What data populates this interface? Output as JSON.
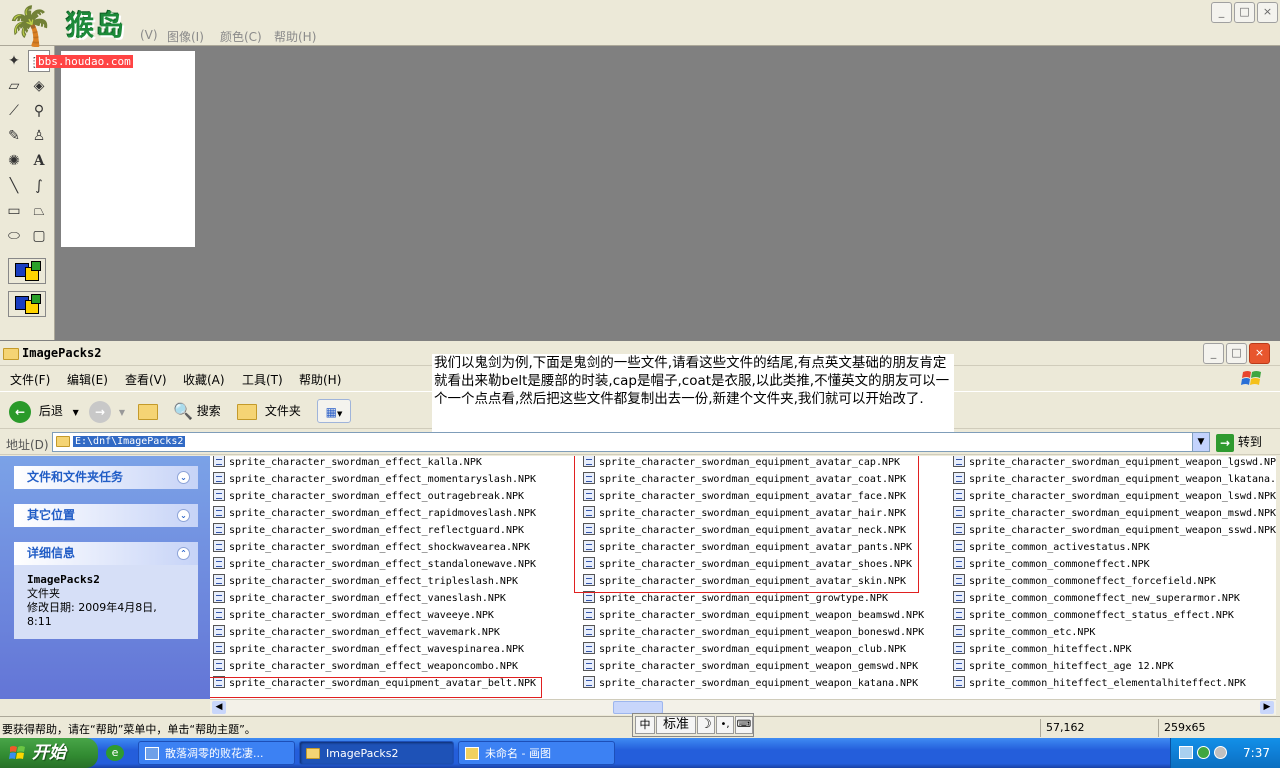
{
  "paint": {
    "menu": [
      "图像(I)",
      "颜色(C)",
      "帮助(H)"
    ],
    "menu_partial": "(V)",
    "logo_brand": "猴岛",
    "logo_site": "bbs.houdao.com"
  },
  "explorer": {
    "title": "ImagePacks2",
    "menu": [
      "文件(F)",
      "编辑(E)",
      "查看(V)",
      "收藏(A)",
      "工具(T)",
      "帮助(H)"
    ],
    "toolbar": {
      "back": "后退",
      "search": "搜索",
      "folders": "文件夹"
    },
    "address": {
      "label": "地址(D)",
      "path": "E:\\dnf\\ImagePacks2",
      "go": "转到"
    },
    "tasks": {
      "file_tasks": "文件和文件夹任务",
      "other_places": "其它位置",
      "details": "详细信息",
      "details_name": "ImagePacks2",
      "details_type": "文件夹",
      "details_date_label": "修改日期:",
      "details_date_value": "2009年4月8日,",
      "details_time": "8:11"
    },
    "columns": [
      [
        "sprite_character_swordman_effect_kalla.NPK",
        "sprite_character_swordman_effect_momentaryslash.NPK",
        "sprite_character_swordman_effect_outragebreak.NPK",
        "sprite_character_swordman_effect_rapidmoveslash.NPK",
        "sprite_character_swordman_effect_reflectguard.NPK",
        "sprite_character_swordman_effect_shockwavearea.NPK",
        "sprite_character_swordman_effect_standalonewave.NPK",
        "sprite_character_swordman_effect_tripleslash.NPK",
        "sprite_character_swordman_effect_vaneslash.NPK",
        "sprite_character_swordman_effect_waveeye.NPK",
        "sprite_character_swordman_effect_wavemark.NPK",
        "sprite_character_swordman_effect_wavespinarea.NPK",
        "sprite_character_swordman_effect_weaponcombo.NPK",
        "sprite_character_swordman_equipment_avatar_belt.NPK"
      ],
      [
        "sprite_character_swordman_equipment_avatar_cap.NPK",
        "sprite_character_swordman_equipment_avatar_coat.NPK",
        "sprite_character_swordman_equipment_avatar_face.NPK",
        "sprite_character_swordman_equipment_avatar_hair.NPK",
        "sprite_character_swordman_equipment_avatar_neck.NPK",
        "sprite_character_swordman_equipment_avatar_pants.NPK",
        "sprite_character_swordman_equipment_avatar_shoes.NPK",
        "sprite_character_swordman_equipment_avatar_skin.NPK",
        "sprite_character_swordman_equipment_growtype.NPK",
        "sprite_character_swordman_equipment_weapon_beamswd.NPK",
        "sprite_character_swordman_equipment_weapon_boneswd.NPK",
        "sprite_character_swordman_equipment_weapon_club.NPK",
        "sprite_character_swordman_equipment_weapon_gemswd.NPK",
        "sprite_character_swordman_equipment_weapon_katana.NPK"
      ],
      [
        "sprite_character_swordman_equipment_weapon_lgswd.NPK",
        "sprite_character_swordman_equipment_weapon_lkatana.",
        "sprite_character_swordman_equipment_weapon_lswd.NPK",
        "sprite_character_swordman_equipment_weapon_mswd.NPK",
        "sprite_character_swordman_equipment_weapon_sswd.NPK",
        "sprite_common_activestatus.NPK",
        "sprite_common_commoneffect.NPK",
        "sprite_common_commoneffect_forcefield.NPK",
        "sprite_common_commoneffect_new_superarmor.NPK",
        "sprite_common_commoneffect_status_effect.NPK",
        "sprite_common_etc.NPK",
        "sprite_common_hiteffect.NPK",
        "sprite_common_hiteffect_age 12.NPK",
        "sprite_common_hiteffect_elementalhiteffect.NPK"
      ]
    ],
    "status": {
      "help_text": "要获得帮助，请在“帮助”菜单中，单击“帮助主题”。",
      "coords": "57,162",
      "size": "259x65"
    }
  },
  "note": "我们以鬼剑为例,下面是鬼剑的一些文件,请看这些文件的结尾,有点英文基础的朋友肯定就看出来勒belt是腰部的时装,cap是帽子,coat是衣服,以此类推,不懂英文的朋友可以一个一个点点看,然后把这些文件都复制出去一份,新建个文件夹,我们就可以开始改了.",
  "ime": {
    "mode": "标准"
  },
  "taskbar": {
    "start": "开始",
    "tasks": [
      "散落凋零的败花凄...",
      "ImagePacks2",
      "未命名 - 画图"
    ],
    "clock": "7:37"
  }
}
